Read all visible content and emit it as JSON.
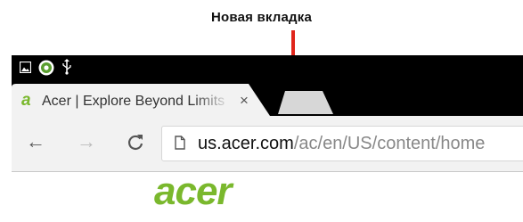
{
  "annotation": {
    "caption": "Новая вкладка"
  },
  "browser": {
    "status_icons": [
      "image-icon",
      "chrome-app-icon",
      "usb-icon"
    ],
    "tab": {
      "logo_letter": "a",
      "title": "Acer | Explore Beyond Limits",
      "close_glyph": "×"
    },
    "new_tab_button": "new-tab-icon",
    "nav": {
      "back": "←",
      "forward": "→",
      "reload": "C"
    },
    "address": {
      "host": "us.acer.com",
      "path": "/ac/en/US/content/home"
    }
  },
  "page": {
    "logo": "acer"
  },
  "colors": {
    "accent_arrow": "#e0251b",
    "brand_green": "#7ab82d"
  }
}
